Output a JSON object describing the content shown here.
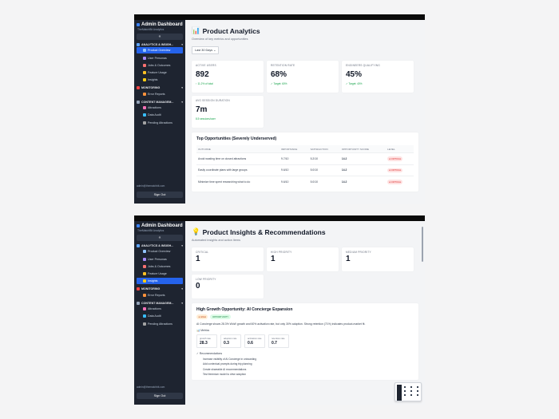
{
  "sidebar": {
    "brand": "Admin Dashboard",
    "brand_sub": "TheMatchBit Analytics",
    "collapse_icon": "«",
    "sections": {
      "analytics": "ANALYTICS & INSIGH...",
      "monitoring": "MONITORING",
      "content": "CONTENT MANAGEM..."
    },
    "items": {
      "product_overview": "Product Overview",
      "user_personas": "User Personas",
      "jobs_outcomes": "Jobs & Outcomes",
      "feature_usage": "Feature Usage",
      "insights": "Insights",
      "error_reports": "Error Reports",
      "attractions": "Attractions",
      "data_audit": "Data Audit",
      "pending_attractions": "Pending Attractions"
    },
    "email": "admin@thematchbit.com",
    "sign_out": "Sign Out"
  },
  "top": {
    "title": "Product Analytics",
    "subtitle": "Overview of key metrics and opportunities",
    "range": "Last 30 Days",
    "cards": [
      {
        "label": "ACTIVE USERS",
        "value": "892",
        "sub": "↑ 11.2% of total"
      },
      {
        "label": "RETENTION RATE",
        "value": "68%",
        "sub": "✓ Target: 60%"
      },
      {
        "label": "ENGINEERS QUALIFYING",
        "value": "45%",
        "sub": "✓ Target: 40%"
      },
      {
        "label": "AVG SESSION DURATION",
        "value": "7m",
        "sub": "8.5 sessions/user"
      }
    ],
    "table": {
      "title": "Top Opportunities (Severely Underserved)",
      "headers": [
        "OUTCOME",
        "IMPORTANCE",
        "SATISFACTION",
        "OPPORTUNITY SCORE",
        "LEVEL"
      ],
      "rows": [
        [
          "Avoid wasting time on closed attractions",
          "9.7/10",
          "5.2/10",
          "14.2",
          "CRITICAL"
        ],
        [
          "Easily coordinate plans with large groups",
          "9.6/10",
          "5.0/10",
          "14.2",
          "CRITICAL"
        ],
        [
          "Minimize time spent researching what to do",
          "9.6/10",
          "5.0/10",
          "14.2",
          "CRITICAL"
        ]
      ]
    }
  },
  "bottom": {
    "title": "Product Insights & Recommendations",
    "subtitle": "Automated insights and action items",
    "cards": [
      {
        "label": "CRITICAL",
        "value": "1"
      },
      {
        "label": "HIGH PRIORITY",
        "value": "1"
      },
      {
        "label": "MEDIUM PRIORITY",
        "value": "1"
      },
      {
        "label": "LOW PRIORITY",
        "value": "0"
      }
    ],
    "insight": {
      "title": "High Growth Opportunity: AI Concierge Expansion",
      "badge_priority": "HIGH",
      "badge_type": "OPPORTUNITY",
      "description": "AI Concierge shows 28.3% WoW growth and 60% activation rate, but only 30% adoption. Strong retention (71%) indicates product-market fit.",
      "metrics_label": "Metrics",
      "metrics": [
        {
          "k": "growth rate",
          "v": "28.3"
        },
        {
          "k": "adoption rate",
          "v": "0.3"
        },
        {
          "k": "activation rate",
          "v": "0.6"
        },
        {
          "k": "retention rate",
          "v": "0.7"
        }
      ],
      "recs_label": "Recommendations",
      "recs": [
        "Increase visibility of AI Concierge in onboarding",
        "Add contextual prompts during trip planning",
        "Create shareable AI recommendations",
        "Test freemium model to drive adoption"
      ]
    }
  },
  "colors": {
    "accent": "#2563eb",
    "sidebar": "#1e2430",
    "critical": "#dc2626",
    "success": "#16a34a"
  }
}
